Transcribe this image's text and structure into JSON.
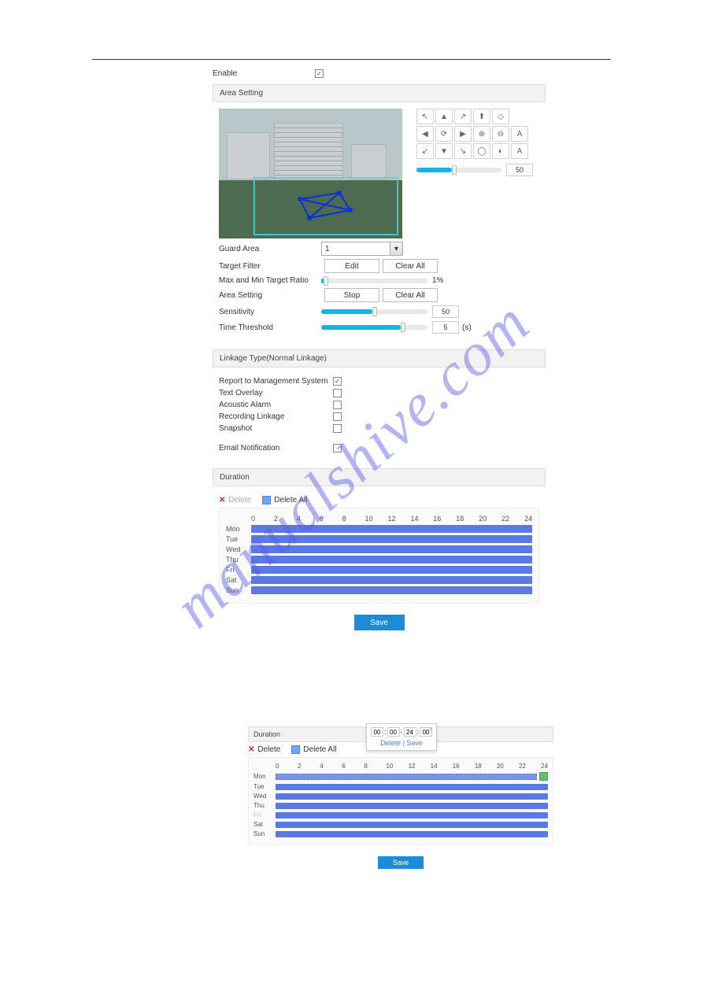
{
  "enable": {
    "label": "Enable",
    "checked": true
  },
  "sections": {
    "area": "Area Setting",
    "linkage": "Linkage Type(Normal Linkage)",
    "duration": "Duration"
  },
  "ptz": {
    "speed": "50"
  },
  "settings": {
    "guard_area": {
      "label": "Guard Area",
      "value": "1"
    },
    "target_filter": {
      "label": "Target Filter",
      "edit": "Edit",
      "clear": "Clear All"
    },
    "ratio": {
      "label": "Max and Min Target Ratio",
      "value": "1%"
    },
    "area_setting": {
      "label": "Area Setting",
      "stop": "Stop",
      "clear": "Clear All"
    },
    "sensitivity": {
      "label": "Sensitivity",
      "value": "50",
      "fill": 48
    },
    "time_threshold": {
      "label": "Time Threshold",
      "value": "5",
      "unit": "(s)",
      "fill": 75
    }
  },
  "linkage": {
    "report": {
      "label": "Report to Management System",
      "checked": true
    },
    "text_overlay": {
      "label": "Text Overlay",
      "checked": false
    },
    "acoustic": {
      "label": "Acoustic Alarm",
      "checked": false
    },
    "recording": {
      "label": "Recording Linkage",
      "checked": false
    },
    "snapshot": {
      "label": "Snapshot",
      "checked": false
    },
    "email": {
      "label": "Email Notification",
      "checked": false
    }
  },
  "toolbar": {
    "delete": "Delete",
    "delete_all": "Delete All"
  },
  "hours": [
    "0",
    "2",
    "4",
    "6",
    "8",
    "10",
    "12",
    "14",
    "16",
    "18",
    "20",
    "22",
    "24"
  ],
  "days": [
    "Mon",
    "Tue",
    "Wed",
    "Thu",
    "Fri",
    "Sat",
    "Sun"
  ],
  "save": "Save",
  "popup": {
    "h1": "00",
    "m1": "00",
    "h2": "24",
    "m2": "00",
    "delete": "Delete",
    "save": "Save",
    "sep": " | "
  },
  "watermark": "manualshive.com"
}
